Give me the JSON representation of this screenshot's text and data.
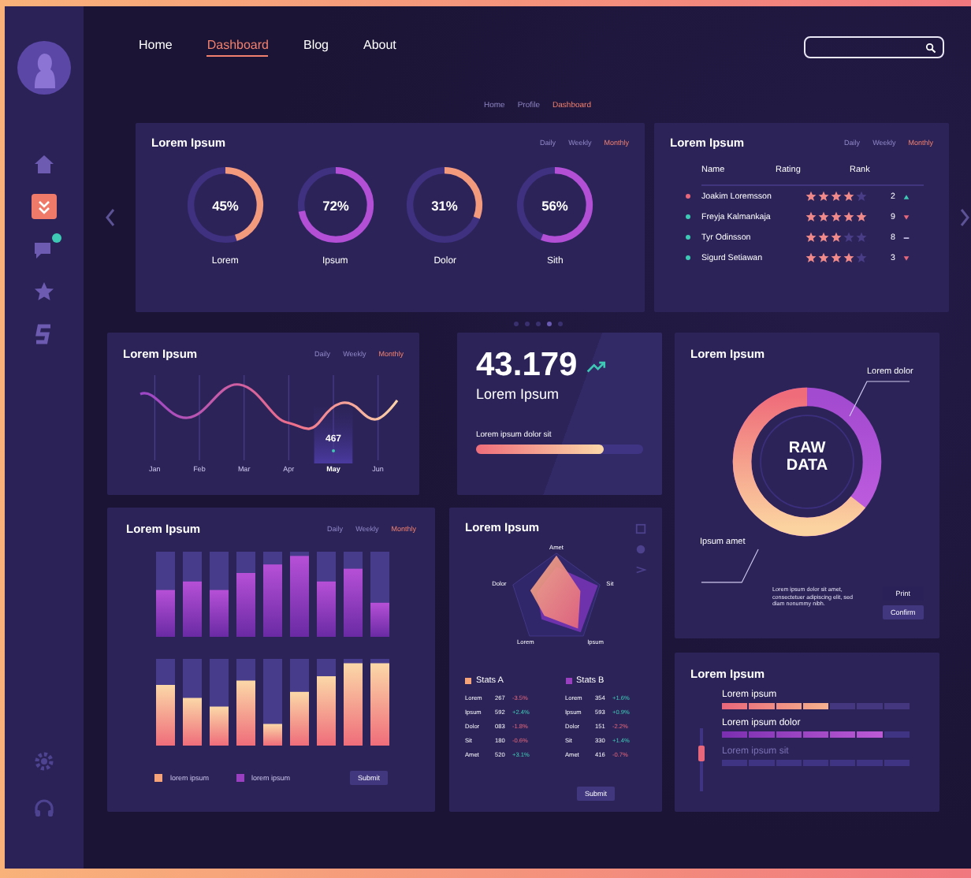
{
  "sidebar": {
    "items": [
      {
        "kind": "home",
        "selected": false,
        "notification": false
      },
      {
        "kind": "tasks",
        "selected": true,
        "notification": false
      },
      {
        "kind": "chat",
        "selected": false,
        "notification": true
      },
      {
        "kind": "star",
        "selected": false,
        "notification": false
      },
      {
        "kind": "logo",
        "selected": false,
        "notification": false
      }
    ],
    "bottom_items": [
      {
        "kind": "settings"
      },
      {
        "kind": "support"
      }
    ]
  },
  "nav": {
    "items": [
      {
        "label": "Home",
        "selected": false
      },
      {
        "label": "Dashboard",
        "selected": true
      },
      {
        "label": "Blog",
        "selected": false
      },
      {
        "label": "About",
        "selected": false
      }
    ]
  },
  "breadcrumb": [
    {
      "label": "Home",
      "selected": false
    },
    {
      "label": "Profile",
      "selected": false
    },
    {
      "label": "Dashboard",
      "selected": true
    }
  ],
  "progress_card": {
    "title": "Lorem Ipsum",
    "periods": [
      {
        "label": "Daily",
        "selected": false
      },
      {
        "label": "Weekly",
        "selected": false
      },
      {
        "label": "Monthly",
        "selected": true
      }
    ],
    "meters": [
      {
        "label": "Lorem",
        "reading": "45%",
        "level": 0.45,
        "color": "#f39a7c"
      },
      {
        "label": "Ipsum",
        "reading": "72%",
        "level": 0.72,
        "color": "#b24fd4"
      },
      {
        "label": "Dolor",
        "reading": "31%",
        "level": 0.31,
        "color": "#f39a7c"
      },
      {
        "label": "Sith",
        "reading": "56%",
        "level": 0.56,
        "color": "#b24fd4"
      }
    ]
  },
  "ranking_card": {
    "title": "Lorem Ipsum",
    "periods": [
      {
        "label": "Daily",
        "selected": false
      },
      {
        "label": "Weekly",
        "selected": false
      },
      {
        "label": "Monthly",
        "selected": true
      }
    ],
    "columns": [
      "Name",
      "Rating",
      "Rank"
    ],
    "rows": [
      {
        "name": "Joakim Loremsson",
        "color": "#e8677a",
        "stars": 4,
        "rank": "2",
        "kind": "up"
      },
      {
        "name": "Freyja Kalmankaja",
        "color": "#3ec9b5",
        "stars": 5,
        "rank": "9",
        "kind": "down"
      },
      {
        "name": "Tyr Odinsson",
        "color": "#3ec9b5",
        "stars": 3,
        "rank": "8",
        "kind": "flat"
      },
      {
        "name": "Sigurd Setiawan",
        "color": "#3ec9b5",
        "stars": 4,
        "rank": "3",
        "kind": "down"
      }
    ]
  },
  "carousel": {
    "pages": [
      {
        "selected": false
      },
      {
        "selected": false
      },
      {
        "selected": false
      },
      {
        "selected": true
      },
      {
        "selected": false
      }
    ]
  },
  "line_card": {
    "title": "Lorem Ipsum",
    "periods": [
      {
        "label": "Daily",
        "selected": false
      },
      {
        "label": "Weekly",
        "selected": false
      },
      {
        "label": "Monthly",
        "selected": true
      }
    ],
    "months": [
      {
        "label": "Jan",
        "selected": false
      },
      {
        "label": "Feb",
        "selected": false
      },
      {
        "label": "Mar",
        "selected": false
      },
      {
        "label": "Apr",
        "selected": false
      },
      {
        "label": "May",
        "selected": true
      },
      {
        "label": "Jun",
        "selected": false
      }
    ],
    "tooltip": "467"
  },
  "total_card": {
    "value": "43.179",
    "label": "Lorem Ipsum",
    "progress_label": "Lorem ipsum dolor sit",
    "level": 0.76
  },
  "raw_data_card": {
    "title": "Lorem Ipsum",
    "center": "RAW DATA",
    "labels": [
      "Lorem dolor",
      "Ipsum amet"
    ],
    "note": "Lorem ipsum dolor sit amet, consectetuer adipiscing elit, sed diam nonummy nibh.",
    "buttons": [
      "Print",
      "Confirm"
    ]
  },
  "bar_card": {
    "title": "Lorem Ipsum",
    "periods": [
      {
        "label": "Daily",
        "selected": false
      },
      {
        "label": "Weekly",
        "selected": false
      },
      {
        "label": "Monthly",
        "selected": true
      }
    ],
    "legend": [
      {
        "label": "lorem ipsum",
        "color": "#f7a37a"
      },
      {
        "label": "lorem ipsum",
        "color": "#9a3fc0"
      }
    ],
    "button": "Submit"
  },
  "radar_card": {
    "title": "Lorem Ipsum",
    "axes": [
      "Amet",
      "Sit",
      "Ipsum",
      "Lorem",
      "Dolor"
    ],
    "tables": [
      {
        "title": "Stats A",
        "color": "#f7a37a",
        "rows": [
          {
            "label": "Lorem",
            "value": "267",
            "change": "-3.5%",
            "kind": "down"
          },
          {
            "label": "Ipsum",
            "value": "592",
            "change": "+2.4%",
            "kind": "up"
          },
          {
            "label": "Dolor",
            "value": "083",
            "change": "-1.8%",
            "kind": "down"
          },
          {
            "label": "Sit",
            "value": "180",
            "change": "-0.6%",
            "kind": "down"
          },
          {
            "label": "Amet",
            "value": "520",
            "change": "+3.1%",
            "kind": "up"
          }
        ]
      },
      {
        "title": "Stats B",
        "color": "#9a3fc0",
        "rows": [
          {
            "label": "Lorem",
            "value": "354",
            "change": "+1.6%",
            "kind": "up"
          },
          {
            "label": "Ipsum",
            "value": "593",
            "change": "+0.9%",
            "kind": "up"
          },
          {
            "label": "Dolor",
            "value": "151",
            "change": "-2.2%",
            "kind": "down"
          },
          {
            "label": "Sit",
            "value": "330",
            "change": "+1.4%",
            "kind": "up"
          },
          {
            "label": "Amet",
            "value": "416",
            "change": "-0.7%",
            "kind": "down"
          }
        ]
      }
    ],
    "button": "Submit"
  },
  "levels_card": {
    "title": "Lorem Ipsum",
    "slider": {
      "level": 0.35
    },
    "bars": [
      {
        "label": "Lorem ipsum",
        "level": 0.57,
        "kind": "warm",
        "disabled": false
      },
      {
        "label": "Lorem ipsum dolor",
        "level": 0.86,
        "kind": "cool",
        "disabled": false
      },
      {
        "label": "Lorem ipsum sit",
        "level": 0,
        "kind": "cool",
        "disabled": true
      }
    ]
  }
}
